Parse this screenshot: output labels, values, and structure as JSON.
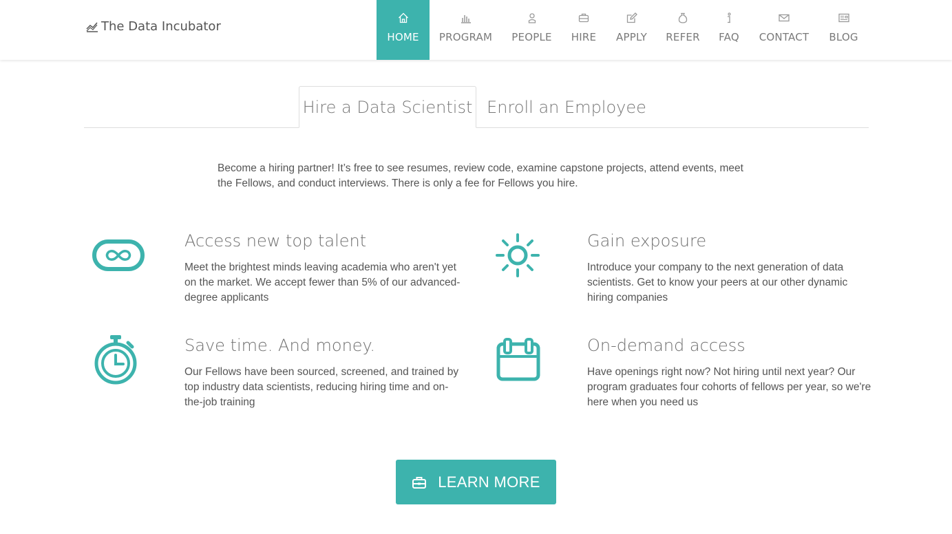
{
  "brand": {
    "name": "The Data Incubator",
    "icon": "chart-line-icon"
  },
  "nav": {
    "items": [
      {
        "label": "HOME",
        "icon": "home-icon",
        "active": true
      },
      {
        "label": "PROGRAM",
        "icon": "bar-chart-icon"
      },
      {
        "label": "PEOPLE",
        "icon": "person-icon"
      },
      {
        "label": "HIRE",
        "icon": "briefcase-icon"
      },
      {
        "label": "APPLY",
        "icon": "pencil-icon"
      },
      {
        "label": "REFER",
        "icon": "sack-icon"
      },
      {
        "label": "FAQ",
        "icon": "info-icon"
      },
      {
        "label": "CONTACT",
        "icon": "envelope-icon"
      },
      {
        "label": "BLOG",
        "icon": "newspaper-icon"
      }
    ]
  },
  "tabs": [
    {
      "label": "Hire a Data Scientist",
      "active": true
    },
    {
      "label": "Enroll an Employee",
      "active": false
    }
  ],
  "intro": "Become a hiring partner! It’s free to see resumes, review code, examine capstone projects, attend events, meet the Fellows, and conduct interviews. There is only a fee for Fellows you hire.",
  "features": [
    {
      "title": "Access new top talent",
      "text": "Meet the brightest minds leaving academia who aren't yet on the market. We accept fewer than 5% of our advanced-degree applicants",
      "icon": "infinity-icon"
    },
    {
      "title": "Gain exposure",
      "text": "Introduce your company to the next generation of data scientists. Get to know your peers at our other dynamic hiring companies",
      "icon": "sun-icon"
    },
    {
      "title": "Save time. And money.",
      "text": "Our Fellows have been sourced, screened, and trained by top industry data scientists, reducing hiring time and on-the-job training",
      "icon": "stopwatch-icon"
    },
    {
      "title": "On-demand access",
      "text": "Have openings right now? Not hiring until next year? Our program graduates four cohorts of fellows per year, so we're here when you need us",
      "icon": "calendar-icon"
    }
  ],
  "cta": {
    "label": "LEARN MORE",
    "icon": "briefcase-icon"
  },
  "colors": {
    "accent": "#3db3ad",
    "text": "#555555",
    "nav_text": "#7a7a7a"
  }
}
